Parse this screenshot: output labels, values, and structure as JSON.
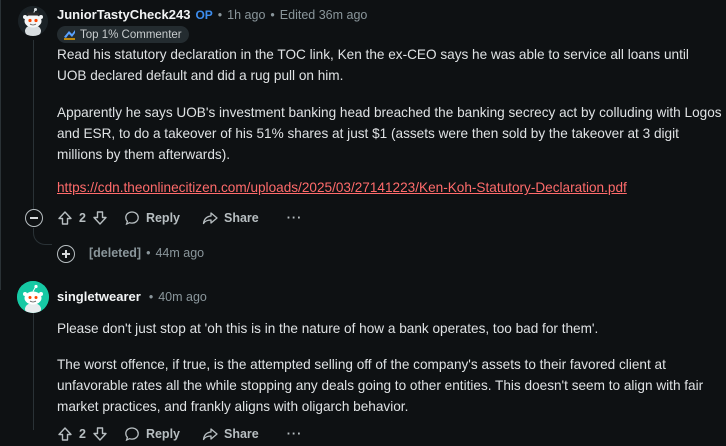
{
  "comment1": {
    "author": "JuniorTastyCheck243",
    "op_badge": "OP",
    "time": "1h ago",
    "edited": "Edited 36m ago",
    "flair": "Top 1% Commenter",
    "paragraphs": [
      "Read his statutory declaration in the TOC link, Ken the ex-CEO says he was able to service all loans until UOB declared default and did a rug pull on him.",
      "Apparently he says UOB's investment banking head breached the banking secrecy act by colluding with Logos and ESR, to do a takeover of his 51% shares at just $1 (assets were then sold by the takeover at 3 digit millions by them afterwards)."
    ],
    "link": "https://cdn.theonlinecitizen.com/uploads/2025/03/27141223/Ken-Koh-Statutory-Declaration.pdf",
    "votes": "2",
    "reply_label": "Reply",
    "share_label": "Share",
    "more_label": "···"
  },
  "deleted_reply": {
    "author": "[deleted]",
    "time": "44m ago"
  },
  "comment2": {
    "author": "singletwearer",
    "time": "40m ago",
    "paragraphs": [
      "Please don't just stop at 'oh this is in the nature of how a bank operates, too bad for them'.",
      "The worst offence, if true, is the attempted selling off of the company's assets to their favored client at unfavorable rates all the while stopping any deals going to other entities. This doesn't seem to align with fair market practices, and frankly aligns with oligarch behavior."
    ],
    "votes": "2",
    "reply_label": "Reply",
    "share_label": "Share",
    "more_label": "···"
  },
  "separator": "•",
  "colors": {
    "background": "#0e1113",
    "op_blue": "#3d8ef0",
    "link_red": "#ff6b6b",
    "avatar2_teal": "#16c9a4"
  }
}
